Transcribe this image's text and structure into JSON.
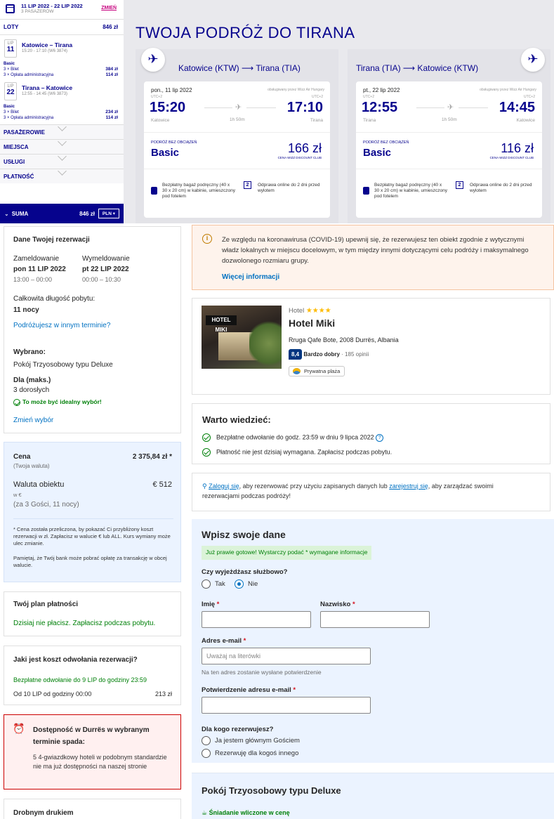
{
  "wizz": {
    "dates": "11 LIP 2022 - 22 LIP 2022",
    "passengers": "3 PASAŻERÓW",
    "change": "ZMIEŃ",
    "flights_label": "LOTY",
    "flights_total": "846 zł",
    "outbound": {
      "month": "LIP",
      "day": "11",
      "route": "Katowice – Tirana",
      "info": "15:20 - 17:10 (W6 3874)",
      "fare": "Basic",
      "tickets": "3 × Bilet",
      "tickets_price": "384 zł",
      "admin": "3 × Opłata administracyjna",
      "admin_price": "114 zł"
    },
    "inbound": {
      "month": "LIP",
      "day": "22",
      "route": "Tirana – Katowice",
      "info": "12:55 - 14:45 (W6 3873)",
      "fare": "Basic",
      "tickets": "3 × Bilet",
      "tickets_price": "234 zł",
      "admin": "3 × Opłata administracyjna",
      "admin_price": "114 zł"
    },
    "sections": [
      "PASAŻEROWIE",
      "MIEJSCA",
      "USŁUGI",
      "PŁATNOŚĆ"
    ],
    "suma_label": "SUMA",
    "suma_value": "846 zł",
    "currency": "PLN",
    "page_title": "TWOJA PODRÓŻ DO TIRANA",
    "cards": [
      {
        "route": "Katowice (KTW) ⟶ Tirana (TIA)",
        "date": "pon., 11 lip 2022",
        "operated": "obsługiwany przez Wizz Air Hungary",
        "utc1": "UTC+2",
        "utc2": "UTC+2",
        "dep": "15:20",
        "arr": "17:10",
        "from": "Katowice",
        "to": "Tirana",
        "duration": "1h 50m",
        "fare_small": "PODRÓŻ BEZ OBCIĄŻEŃ",
        "fare": "Basic",
        "price": "166 zł",
        "club": "CENA WIZZ DISCOUNT CLUB",
        "bag": "Bezpłatny bagaż podręczny (40 x 30 x 20 cm) w kabinie, umieszczony pod fotelem",
        "checkin": "Odprawa online do 2 dni przed wylotem"
      },
      {
        "route": "Tirana (TIA) ⟶ Katowice (KTW)",
        "date": "pt., 22 lip 2022",
        "operated": "obsługiwany przez Wizz Air Hungary",
        "utc1": "UTC+2",
        "utc2": "UTC+2",
        "dep": "12:55",
        "arr": "14:45",
        "from": "Tirana",
        "to": "Katowice",
        "duration": "1h 50m",
        "fare_small": "PODRÓŻ BEZ OBCIĄŻEŃ",
        "fare": "Basic",
        "price": "116 zł",
        "club": "CENA WIZZ DISCOUNT CLUB",
        "bag": "Bezpłatny bagaż podręczny (40 x 30 x 20 cm) w kabinie, umieszczony pod fotelem",
        "checkin": "Odprawa online do 2 dni przed wylotem"
      }
    ]
  },
  "booking": {
    "reservation": {
      "title": "Dane Twojej rezerwacji",
      "checkin_label": "Zameldowanie",
      "checkin_date": "pon 11 LIP 2022",
      "checkin_time": "13:00 – 00:00",
      "checkout_label": "Wymeldowanie",
      "checkout_date": "pt 22 LIP 2022",
      "checkout_time": "00:00 – 10:30",
      "length_label": "Całkowita długość pobytu:",
      "length": "11 nocy",
      "other_dates": "Podróżujesz w innym terminie?",
      "selected_label": "Wybrano:",
      "selected": "Pokój Trzyosobowy typu Deluxe",
      "for_label": "Dla (maks.)",
      "for": "3 dorosłych",
      "ideal": "To może być idealny wybór!",
      "change": "Zmień wybór"
    },
    "price": {
      "label": "Cena",
      "sub": "(Twoja waluta)",
      "value": "2 375,84 zł *",
      "obj_label": "Waluta obiektu",
      "obj_sub": "w €",
      "obj_value": "€ 512",
      "guests": "(za 3 Gości, 11 nocy)",
      "note1": "* Cena została przeliczona, by pokazać Ci przybliżony koszt rezerwacji w zł. Zapłacisz w walucie € lub ALL. Kurs wymiany może ulec zmianie.",
      "note2": "Pamiętaj, że Twój bank może pobrać opłatę za transakcję w obcej walucie."
    },
    "plan": {
      "title": "Twój plan płatności",
      "text": "Dzisiaj nie płacisz. Zapłacisz podczas pobytu."
    },
    "cancel": {
      "title": "Jaki jest koszt odwołania rezerwacji?",
      "free": "Bezpłatne odwołanie do 9 LIP do godziny 23:59",
      "from": "Od 10 LIP od godziny 00:00",
      "fee": "213 zł"
    },
    "avail": {
      "title": "Dostępność w Durrës w wybranym terminie spada:",
      "text": "5 4-gwiazdkowy hoteli w podobnym standardzie nie ma już dostępności na naszej stronie"
    },
    "fine_print": "Drobnym drukiem",
    "covid": {
      "text": "Ze względu na koronawirusa (COVID-19) upewnij się, że rezerwujesz ten obiekt zgodnie z wytycznymi władz lokalnych w miejscu docelowym, w tym między innymi dotyczącymi celu podróży i maksymalnego dozwolonego rozmiaru grupy.",
      "more": "Więcej informacji"
    },
    "hotel": {
      "type": "Hotel",
      "stars": "★★★★",
      "name": "Hotel Miki",
      "address": "Rruga Qafe Bote, 2008 Durrës, Albania",
      "score": "8,4",
      "score_text": "Bardzo dobry",
      "reviews": "· 185 opinii",
      "tag": "Prywatna plaża",
      "sign": "HOTEL MIKI"
    },
    "good": {
      "title": "Warto wiedzieć:",
      "item1": "Bezpłatne odwołanie do godz. 23:59 w dniu 9 lipca 2022",
      "item2": "Płatność nie jest dzisiaj wymagana. Zapłacisz podczas pobytu."
    },
    "signin": {
      "login": "Zaloguj się",
      "mid": ", aby rezerwować przy użyciu zapisanych danych lub ",
      "register": "zarejestruj się",
      "end": ", aby zarządzać swoimi rezerwacjami podczas podróży!"
    },
    "form": {
      "title": "Wpisz swoje dane",
      "banner": "Już prawie gotowe! Wystarczy podać * wymagane informacje",
      "business": "Czy wyjeżdżasz służbowo?",
      "yes": "Tak",
      "no": "Nie",
      "first": "Imię",
      "last": "Nazwisko",
      "email": "Adres e-mail",
      "email_ph": "Uważaj na literówki",
      "email_hint": "Na ten adres zostanie wysłane potwierdzenie",
      "email2": "Potwierdzenie adresu e-mail",
      "for_whom": "Dla kogo rezerwujesz?",
      "main_guest": "Ja jestem głównym Gościem",
      "other": "Rezerwuję dla kogoś innego",
      "star": "*"
    },
    "room": {
      "title": "Pokój Trzyosobowy typu Deluxe",
      "breakfast": "Śniadanie wliczone w cenę"
    }
  }
}
